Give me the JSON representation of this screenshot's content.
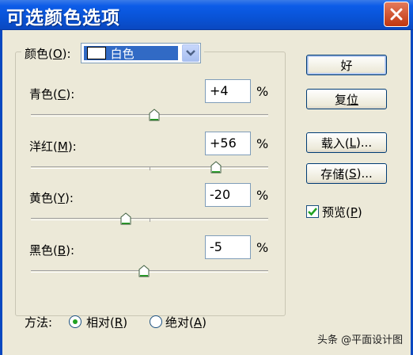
{
  "window": {
    "title": "可选颜色选项"
  },
  "colors": {
    "title_bar": "#0a53d6",
    "selection": "#316ac5",
    "close": "#c1360f",
    "radio_dot": "#21a121"
  },
  "icons": {
    "close": "close-icon",
    "dropdown": "chevron-down-icon",
    "thumb": "slider-thumb-icon"
  },
  "color_select": {
    "label": "颜色(O):",
    "label_pre": "颜色(",
    "label_key": "O",
    "label_post": "):",
    "value": "白色"
  },
  "sliders": [
    {
      "label_pre": "青色(",
      "label_key": "C",
      "label_post": "):",
      "value": "+4",
      "unit": "%",
      "level": 4
    },
    {
      "label_pre": "洋红(",
      "label_key": "M",
      "label_post": "):",
      "value": "+56",
      "unit": "%",
      "level": 56
    },
    {
      "label_pre": "黄色(",
      "label_key": "Y",
      "label_post": "):",
      "value": "-20",
      "unit": "%",
      "level": -20
    },
    {
      "label_pre": "黑色(",
      "label_key": "B",
      "label_post": "):",
      "value": "-5",
      "unit": "%",
      "level": -5
    }
  ],
  "buttons": {
    "ok": "好",
    "reset_pre": "复",
    "reset_key": "位",
    "load_pre": "载入(",
    "load_key": "L",
    "load_post": ")...",
    "save_pre": "存储(",
    "save_key": "S",
    "save_post": ")..."
  },
  "preview": {
    "label_pre": "预览(",
    "label_key": "P",
    "label_post": ")",
    "checked": true
  },
  "method": {
    "label": "方法:",
    "relative_pre": "相对(",
    "relative_key": "R",
    "relative_post": ")",
    "absolute_pre": "绝对(",
    "absolute_key": "A",
    "absolute_post": ")",
    "selected": "relative"
  },
  "watermark": "头条 @平面设计图"
}
